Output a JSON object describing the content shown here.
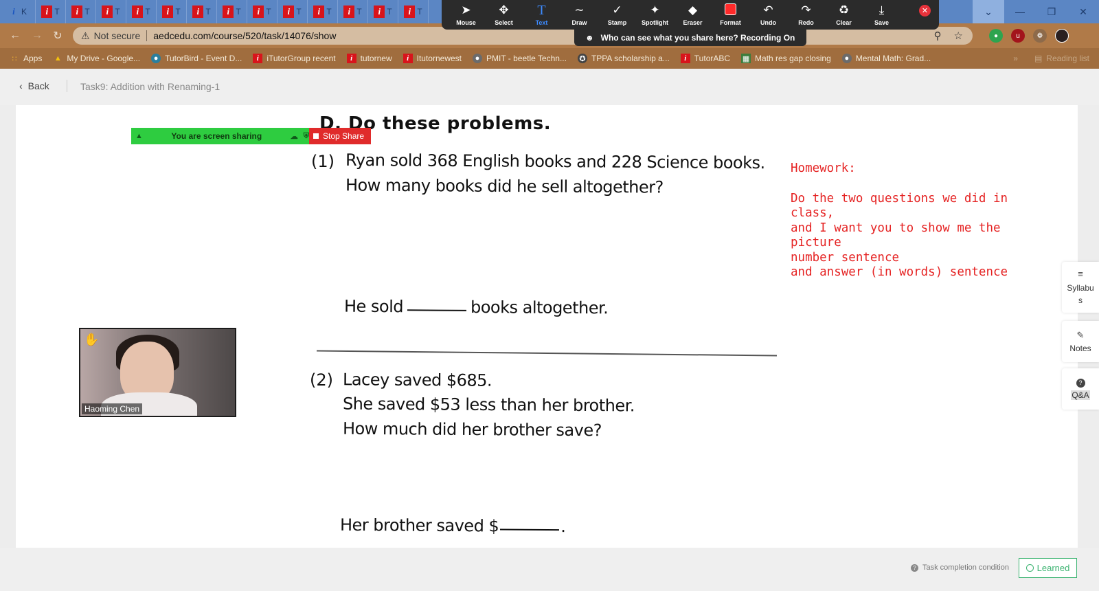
{
  "browser": {
    "tab_glyph": "i",
    "tab_title_initial": "T",
    "first_tab_initial": "K",
    "address": {
      "security_label": "Not secure",
      "url": "aedcedu.com/course/520/task/14076/show"
    },
    "bookmarks": [
      {
        "label": "Apps"
      },
      {
        "label": "My Drive - Google..."
      },
      {
        "label": "TutorBird - Event D..."
      },
      {
        "label": "iTutorGroup recent"
      },
      {
        "label": "tutornew"
      },
      {
        "label": "Itutornewest"
      },
      {
        "label": "PMIT - beetle Techn..."
      },
      {
        "label": "TPPA scholarship a..."
      },
      {
        "label": "TutorABC"
      },
      {
        "label": "Math res gap closing"
      },
      {
        "label": "Mental Math: Grad..."
      }
    ],
    "reading_list": "Reading list"
  },
  "zoom_toolbar": {
    "tools": [
      {
        "label": "Mouse",
        "icon": "cursor-arrow-icon"
      },
      {
        "label": "Select",
        "icon": "move-arrows-icon"
      },
      {
        "label": "Text",
        "icon": "text-t-icon",
        "active": true
      },
      {
        "label": "Draw",
        "icon": "draw-wave-icon"
      },
      {
        "label": "Stamp",
        "icon": "checkmark-icon"
      },
      {
        "label": "Spotlight",
        "icon": "spotlight-wand-icon"
      },
      {
        "label": "Eraser",
        "icon": "eraser-icon"
      },
      {
        "label": "Format",
        "icon": "color-swatch-icon"
      },
      {
        "label": "Undo",
        "icon": "undo-icon"
      },
      {
        "label": "Redo",
        "icon": "redo-icon"
      },
      {
        "label": "Clear",
        "icon": "trash-icon"
      },
      {
        "label": "Save",
        "icon": "download-icon"
      }
    ],
    "format_color": "#ff2a2a",
    "recording_banner": "Who can see what you share here? Recording On"
  },
  "screen_share": {
    "status": "You are screen sharing",
    "stop_label": "Stop Share"
  },
  "video": {
    "participant_name": "Haoming Chen"
  },
  "page": {
    "back_label": "Back",
    "breadcrumb": "Task9:  Addition with Renaming-1"
  },
  "worksheet": {
    "heading": "D.  Do these problems.",
    "problems": [
      {
        "number": "(1)",
        "lines": [
          "Ryan sold 368 English books and 228 Science books.",
          "How many books did he sell altogether?"
        ],
        "answer_prefix": "He sold",
        "answer_suffix": "books altogether."
      },
      {
        "number": "(2)",
        "lines": [
          "Lacey saved $685.",
          "She saved $53 less than her brother.",
          "How much did her brother save?"
        ],
        "answer_prefix": "Her brother saved $",
        "answer_suffix": "."
      }
    ]
  },
  "homework_note": {
    "title": "Homework:",
    "lines": [
      "Do the two questions we did in class,",
      "and I want you to show me the",
      "picture",
      "number sentence",
      "and answer (in words) sentence"
    ],
    "color": "#e52323"
  },
  "side_panel": [
    {
      "label": "Syllabus",
      "icon": "menu-lines-icon"
    },
    {
      "label": "Notes",
      "icon": "pencil-icon"
    },
    {
      "label": "Q&A",
      "icon": "question-circle-icon"
    }
  ],
  "footer": {
    "completion_label": "Task completion condition",
    "learned_label": "Learned"
  }
}
